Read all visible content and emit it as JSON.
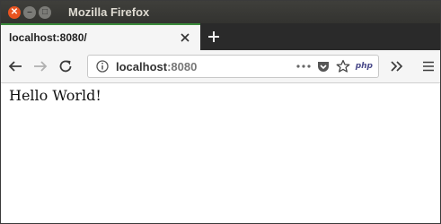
{
  "window": {
    "title": "Mozilla Firefox"
  },
  "tabs": [
    {
      "title": "localhost:8080/"
    }
  ],
  "urlbar": {
    "host": "localhost",
    "port": ":8080",
    "badge": "php"
  },
  "page": {
    "text": "Hello World!"
  },
  "colors": {
    "titlebar": "#3c3b37",
    "close_button": "#e95420",
    "active_tab_indicator": "#3a8a3a",
    "toolbar_bg": "#f5f5f5"
  }
}
